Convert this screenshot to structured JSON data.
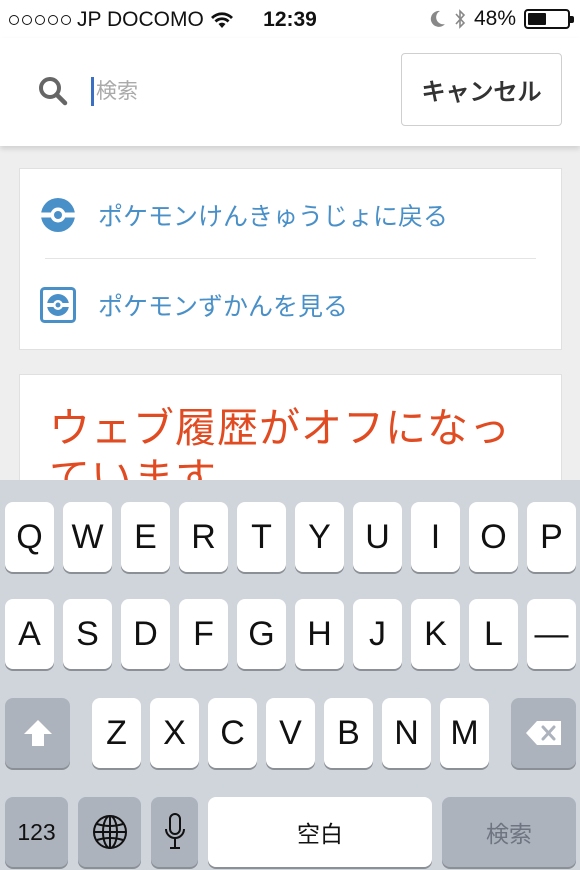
{
  "status_bar": {
    "carrier": "JP DOCOMO",
    "time": "12:39",
    "battery_percent": "48%",
    "battery_level": 0.48,
    "icons": [
      "signal-dots-icon",
      "wifi-icon",
      "moon-icon",
      "bluetooth-icon",
      "battery-icon"
    ]
  },
  "search": {
    "placeholder": "検索",
    "value": "",
    "cancel_label": "キャンセル"
  },
  "nav": {
    "items": [
      {
        "label": "ポケモンけんきゅうじょに戻る",
        "icon": "pokeball-icon"
      },
      {
        "label": "ポケモンずかんを見る",
        "icon": "pokedex-icon"
      }
    ],
    "accent_color": "#4a90c8"
  },
  "history": {
    "message": "ウェブ履歴がオフになっています",
    "color": "#e14b22"
  },
  "keyboard": {
    "row1": [
      "Q",
      "W",
      "E",
      "R",
      "T",
      "Y",
      "U",
      "I",
      "O",
      "P"
    ],
    "row2": [
      "A",
      "S",
      "D",
      "F",
      "G",
      "H",
      "J",
      "K",
      "L",
      "—"
    ],
    "row3": [
      "Z",
      "X",
      "C",
      "V",
      "B",
      "N",
      "M"
    ],
    "numbers_label": "123",
    "space_label": "空白",
    "search_label": "検索",
    "icons": [
      "shift-icon",
      "backspace-icon",
      "globe-icon",
      "microphone-icon"
    ]
  }
}
